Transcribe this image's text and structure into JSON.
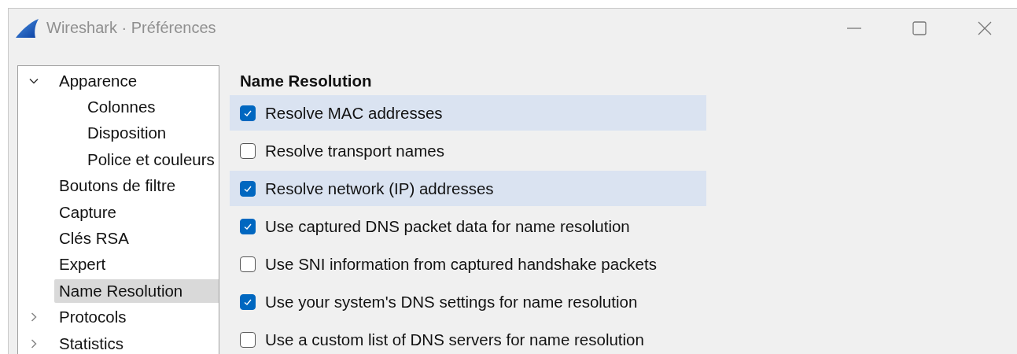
{
  "window": {
    "title": "Wireshark · Préférences"
  },
  "tree": [
    {
      "label": "Apparence",
      "expanded": true,
      "selected": false,
      "children": [
        {
          "label": "Colonnes",
          "selected": false
        },
        {
          "label": "Disposition",
          "selected": false
        },
        {
          "label": "Police et couleurs",
          "selected": false
        }
      ]
    },
    {
      "label": "Boutons de filtre",
      "selected": false
    },
    {
      "label": "Capture",
      "selected": false
    },
    {
      "label": "Clés RSA",
      "selected": false
    },
    {
      "label": "Expert",
      "selected": false
    },
    {
      "label": "Name Resolution",
      "selected": true
    },
    {
      "label": "Protocols",
      "expanded": false,
      "selected": false
    },
    {
      "label": "Statistics",
      "expanded": false,
      "selected": false
    }
  ],
  "section": {
    "title": "Name Resolution",
    "options": [
      {
        "label": "Resolve MAC addresses",
        "checked": true,
        "highlighted": true
      },
      {
        "label": "Resolve transport names",
        "checked": false,
        "highlighted": false
      },
      {
        "label": "Resolve network (IP) addresses",
        "checked": true,
        "highlighted": true
      },
      {
        "label": "Use captured DNS packet data for name resolution",
        "checked": true,
        "highlighted": false
      },
      {
        "label": "Use SNI information from captured handshake packets",
        "checked": false,
        "highlighted": false
      },
      {
        "label": "Use your system's DNS settings for name resolution",
        "checked": true,
        "highlighted": false
      },
      {
        "label": "Use a custom list of DNS servers for name resolution",
        "checked": false,
        "highlighted": false
      }
    ]
  }
}
